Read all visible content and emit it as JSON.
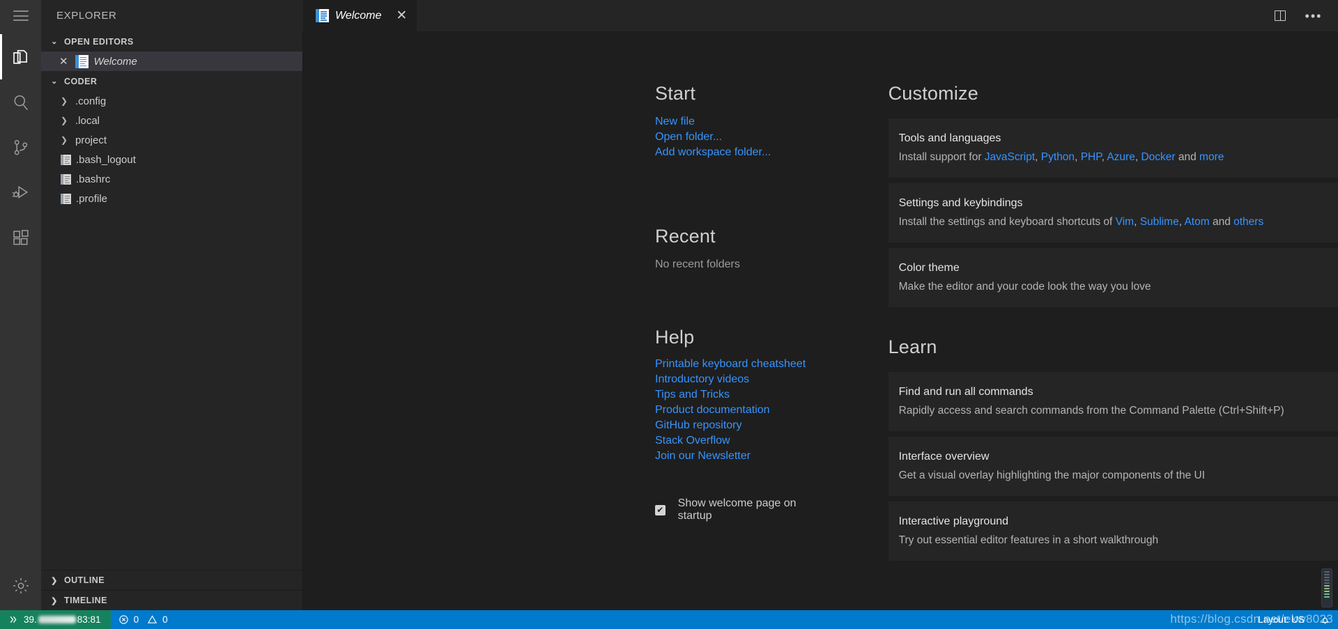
{
  "window": {
    "explorer_title": "EXPLORER",
    "hamburger_icon": "hamburger-menu-icon"
  },
  "activity_bar": {
    "items": [
      {
        "name": "explorer",
        "icon": "files-icon",
        "active": true
      },
      {
        "name": "search",
        "icon": "search-icon",
        "active": false
      },
      {
        "name": "source-control",
        "icon": "source-control-icon",
        "active": false
      },
      {
        "name": "run-and-debug",
        "icon": "run-debug-icon",
        "active": false
      },
      {
        "name": "extensions",
        "icon": "extensions-icon",
        "active": false
      }
    ],
    "bottom": [
      {
        "name": "manage",
        "icon": "gear-icon"
      }
    ]
  },
  "sidebar": {
    "open_editors": {
      "label": "OPEN EDITORS",
      "chevron": "chevron-down-icon",
      "items": [
        {
          "label": "Welcome",
          "close_icon": "close-icon",
          "icon": "welcome-file-icon"
        }
      ]
    },
    "workspace": {
      "label": "CODER",
      "chevron": "chevron-down-icon",
      "items": [
        {
          "label": ".config",
          "type": "folder",
          "chevron": "chevron-right-icon"
        },
        {
          "label": ".local",
          "type": "folder",
          "chevron": "chevron-right-icon"
        },
        {
          "label": "project",
          "type": "folder",
          "chevron": "chevron-right-icon"
        },
        {
          "label": ".bash_logout",
          "type": "file",
          "icon": "file-icon"
        },
        {
          "label": ".bashrc",
          "type": "file",
          "icon": "file-icon"
        },
        {
          "label": ".profile",
          "type": "file",
          "icon": "file-icon"
        }
      ]
    },
    "outline": {
      "label": "OUTLINE",
      "chevron": "chevron-right-icon"
    },
    "timeline": {
      "label": "TIMELINE",
      "chevron": "chevron-right-icon"
    }
  },
  "tabs": [
    {
      "label": "Welcome",
      "icon": "welcome-file-icon",
      "close_icon": "close-icon",
      "active": true
    }
  ],
  "editor_actions": [
    {
      "name": "split-editor",
      "icon": "split-editor-icon"
    },
    {
      "name": "more-actions",
      "icon": "ellipsis-icon"
    }
  ],
  "welcome": {
    "start": {
      "heading": "Start",
      "links": [
        "New file",
        "Open folder...",
        "Add workspace folder..."
      ]
    },
    "recent": {
      "heading": "Recent",
      "empty_text": "No recent folders"
    },
    "help": {
      "heading": "Help",
      "links": [
        "Printable keyboard cheatsheet",
        "Introductory videos",
        "Tips and Tricks",
        "Product documentation",
        "GitHub repository",
        "Stack Overflow",
        "Join our Newsletter"
      ]
    },
    "startup": {
      "checked": true,
      "label": "Show welcome page on startup"
    },
    "customize": {
      "heading": "Customize",
      "cards": [
        {
          "title": "Tools and languages",
          "desc_prefix": "Install support for ",
          "links": [
            "JavaScript",
            "Python",
            "PHP",
            "Azure",
            "Docker"
          ],
          "desc_mid": " and ",
          "more_link": "more"
        },
        {
          "title": "Settings and keybindings",
          "desc_prefix": "Install the settings and keyboard shortcuts of ",
          "links": [
            "Vim",
            "Sublime",
            "Atom"
          ],
          "desc_mid": " and ",
          "more_link": "others"
        },
        {
          "title": "Color theme",
          "desc_plain": "Make the editor and your code look the way you love"
        }
      ]
    },
    "learn": {
      "heading": "Learn",
      "cards": [
        {
          "title": "Find and run all commands",
          "desc_plain": "Rapidly access and search commands from the Command Palette (Ctrl+Shift+P)"
        },
        {
          "title": "Interface overview",
          "desc_plain": "Get a visual overlay highlighting the major components of the UI"
        },
        {
          "title": "Interactive playground",
          "desc_plain": "Try out essential editor features in a short walkthrough"
        }
      ]
    }
  },
  "status_bar": {
    "remote": {
      "icon": "remote-indicator-icon",
      "prefix": "39.",
      "suffix": "83:81"
    },
    "errors": {
      "icon": "error-icon",
      "count": "0"
    },
    "warnings": {
      "icon": "warning-icon",
      "count": "0"
    },
    "keyboard_layout": "Layout: US",
    "bell_icon": "bell-icon",
    "watermark": "https://blog.csdn.net/ekw8023"
  },
  "colors": {
    "accent": "#007acc",
    "remote_green": "#16825d",
    "link": "#3794ff",
    "editor_bg": "#1e1e1e",
    "sidebar_bg": "#252526",
    "activitybar_bg": "#333333"
  }
}
